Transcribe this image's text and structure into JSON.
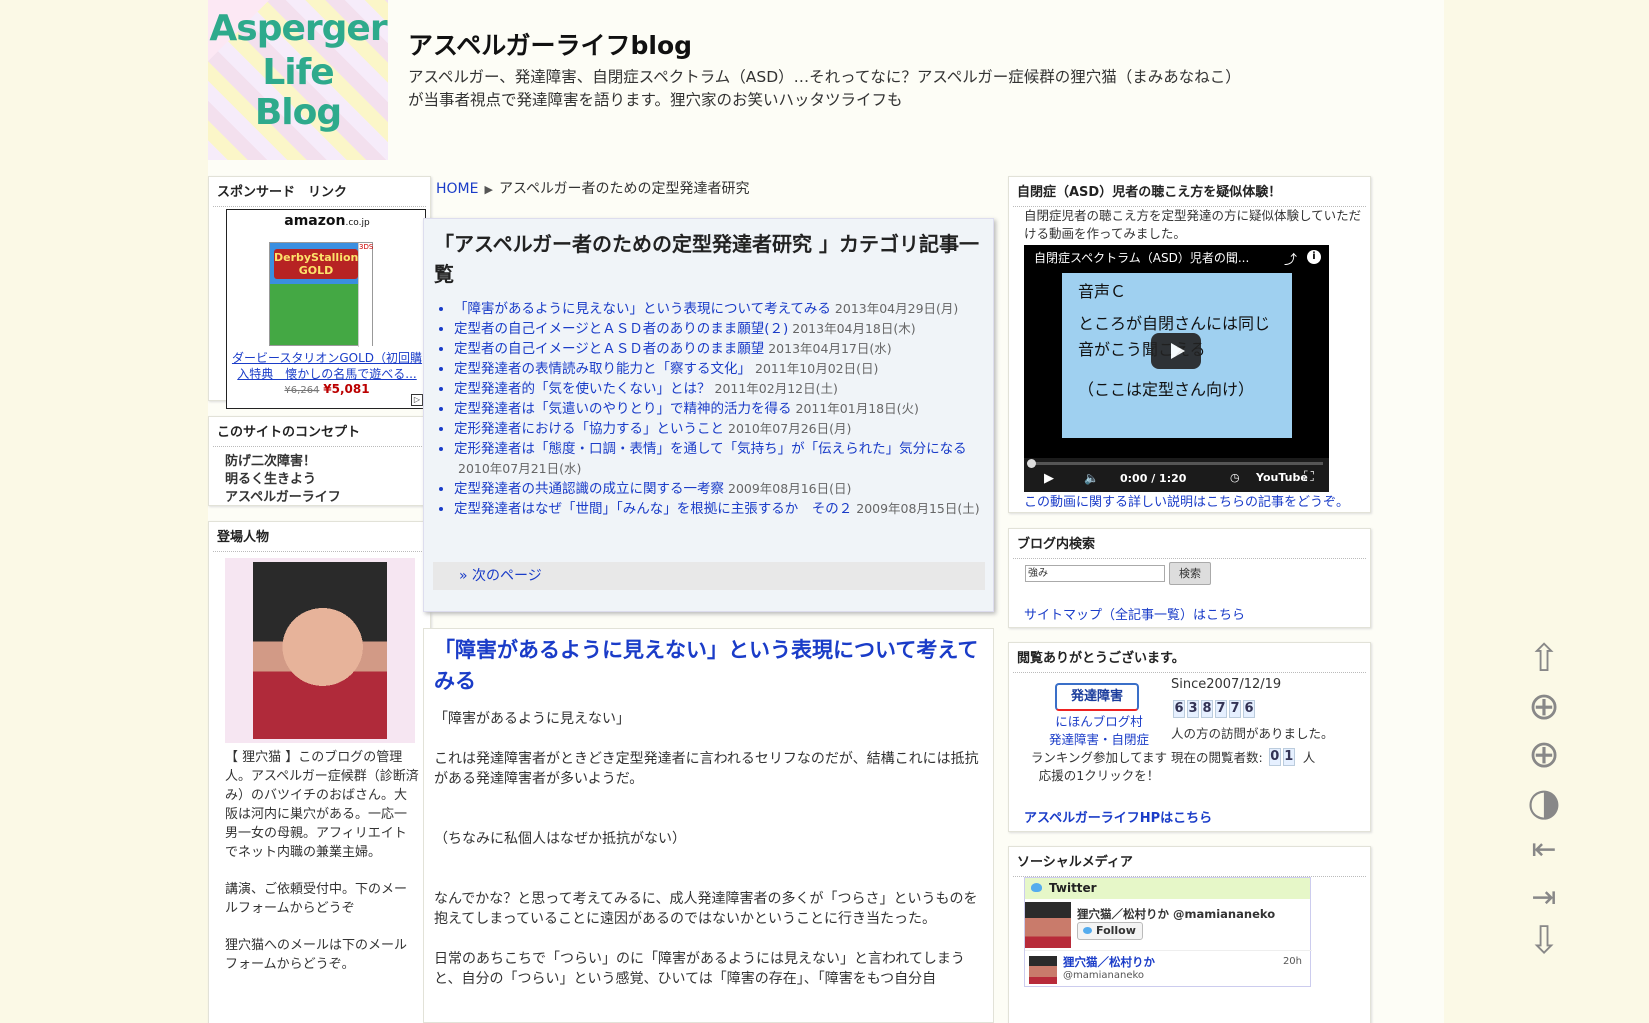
{
  "site": {
    "logo_words": [
      "Asperger",
      "Life",
      "Blog"
    ],
    "title": "アスペルガーライフblog",
    "description": "アスペルガー、発達障害、自閉症スペクトラム（ASD）…それってなに？アスペルガー症候群の狸穴猫（まみあなねこ）が当事者視点で発達障害を語ります。狸穴家のお笑いハッタツライフも"
  },
  "left": {
    "sponsor": {
      "heading": "スポンサード　リンク",
      "amazon_logo": "amazon",
      "amazon_logo_suffix": ".co.jp",
      "product_badge": "DerbyStallion GOLD",
      "product_platform": "3DS",
      "product_link": "ダービースタリオンGOLD（初回購入特典　懐かしの名馬で遊べる...",
      "old_price": "¥6,264",
      "price": "¥5,081"
    },
    "concept": {
      "heading": "このサイトのコンセプト",
      "lines": [
        "防げ二次障害！",
        "明るく生きよう",
        "アスペルガーライフ"
      ]
    },
    "characters": {
      "heading": "登場人物",
      "bio": "【 狸穴猫 】このブログの管理人。アスペルガー症候群（診断済み）のバツイチのおばさん。大阪は河内に巣穴がある。一応一男一女の母親。アフィリエイトでネット内職の兼業主婦。",
      "lecture": "講演、ご依頼受付中。下のメールフォームからどうぞ",
      "mail": "狸穴猫へのメールは下のメールフォームからどうぞ。"
    }
  },
  "breadcrumb": {
    "home": "HOME",
    "separator": "▶",
    "current": "アスペルガー者のための定型発達者研究"
  },
  "category": {
    "title": "「アスペルガー者のための定型発達者研究 」カテゴリ記事一覧",
    "items": [
      {
        "title": "「障害があるように見えない」という表現について考えてみる",
        "date": "2013年04月29日(月)"
      },
      {
        "title": "定型者の自己イメージとＡＳＤ者のありのまま願望(２)",
        "date": "2013年04月18日(木)"
      },
      {
        "title": "定型者の自己イメージとＡＳＤ者のありのまま願望",
        "date": "2013年04月17日(水)"
      },
      {
        "title": "定型発達者の表情読み取り能力と「察する文化」",
        "date": "2011年10月02日(日)"
      },
      {
        "title": "定型発達者的「気を使いたくない」とは？",
        "date": "2011年02月12日(土)"
      },
      {
        "title": "定型発達者は「気遣いのやりとり」で精神的活力を得る",
        "date": "2011年01月18日(火)"
      },
      {
        "title": "定形発達者における「協力する」ということ",
        "date": "2010年07月26日(月)"
      },
      {
        "title": "定形発達者は「態度・口調・表情」を通して「気持ち」が「伝えられた」気分になる",
        "date": "2010年07月21日(水)"
      },
      {
        "title": "定型発達者の共通認識の成立に関する一考察",
        "date": "2009年08月16日(日)"
      },
      {
        "title": "定型発達者はなぜ「世間」「みんな」を根拠に主張するか　その２",
        "date": "2009年08月15日(土)"
      }
    ],
    "next": "» 次のページ"
  },
  "article": {
    "title": "「障害があるように見えない」という表現について考えてみる",
    "paragraphs": [
      "「障害があるように見えない」",
      "",
      "これは発達障害者がときどき定型発達者に言われるセリフなのだが、結構これには抵抗がある発達障害者が多いようだ。",
      "",
      "",
      "（ちなみに私個人はなぜか抵抗がない）",
      "",
      "",
      "なんでかな？と思って考えてみるに、成人発達障害者の多くが「つらさ」というものを抱えてしまっていることに遠因があるのではないかということに行き当たった。",
      "",
      "日常のあちこちで「つらい」のに「障害があるようには見えない」と言われてしまうと、自分の「つらい」という感覚、ひいては「障害の存在」、「障害をもつ自分自"
    ]
  },
  "right": {
    "video": {
      "heading": "自閉症（ASD）児者の聴こえ方を疑似体験！",
      "intro": "自閉症児者の聴こえ方を定型発達の方に疑似体験していただける動画を作ってみました。",
      "title": "自閉症スペクトラム（ASD）児者の聞...",
      "screen_lines": [
        "音声Ｃ",
        "ところが自閉さんには同じ",
        "音がこう聞こえる",
        "（ここは定型さん向け）"
      ],
      "time": "0:00 / 1:20",
      "brand": "YouTube",
      "link": "この動画に関する詳しい説明はこちらの記事をどうぞ。"
    },
    "search": {
      "heading": "ブログ内検索",
      "value": "強み",
      "button": "検索",
      "sitemap": "サイトマップ（全記事一覧）はこちら"
    },
    "visits": {
      "heading": "閲覧ありがとうございます。",
      "banner": "発達障害",
      "village": "にほんブログ村",
      "village_cat": "発達障害・自閉症",
      "ranking": "ランキング参加してます",
      "click": "応援の1クリックを！",
      "since": "Since2007/12/19",
      "count": [
        "6",
        "3",
        "8",
        "7",
        "7",
        "6"
      ],
      "count_suffix": "人の方の訪問がありました。",
      "now_label": "現在の閲覧者数:",
      "now_digits": [
        "0",
        "1"
      ],
      "now_suffix": "人",
      "hp_link": "アスペルガーライフHPはこちら"
    },
    "social": {
      "heading": "ソーシャルメディア",
      "widget_title": "Twitter",
      "name": "狸穴猫／松村りか @mamiananeko",
      "follow": "Follow",
      "tweet_name": "狸穴猫／松村りか",
      "tweet_handle": "@mamiananeko",
      "tweet_time": "20h"
    }
  },
  "tools": [
    "arrow-up-icon",
    "zoom-in-icon",
    "zoom-in-alt-icon",
    "contrast-icon",
    "first-page-icon",
    "last-page-icon",
    "arrow-down-icon"
  ]
}
